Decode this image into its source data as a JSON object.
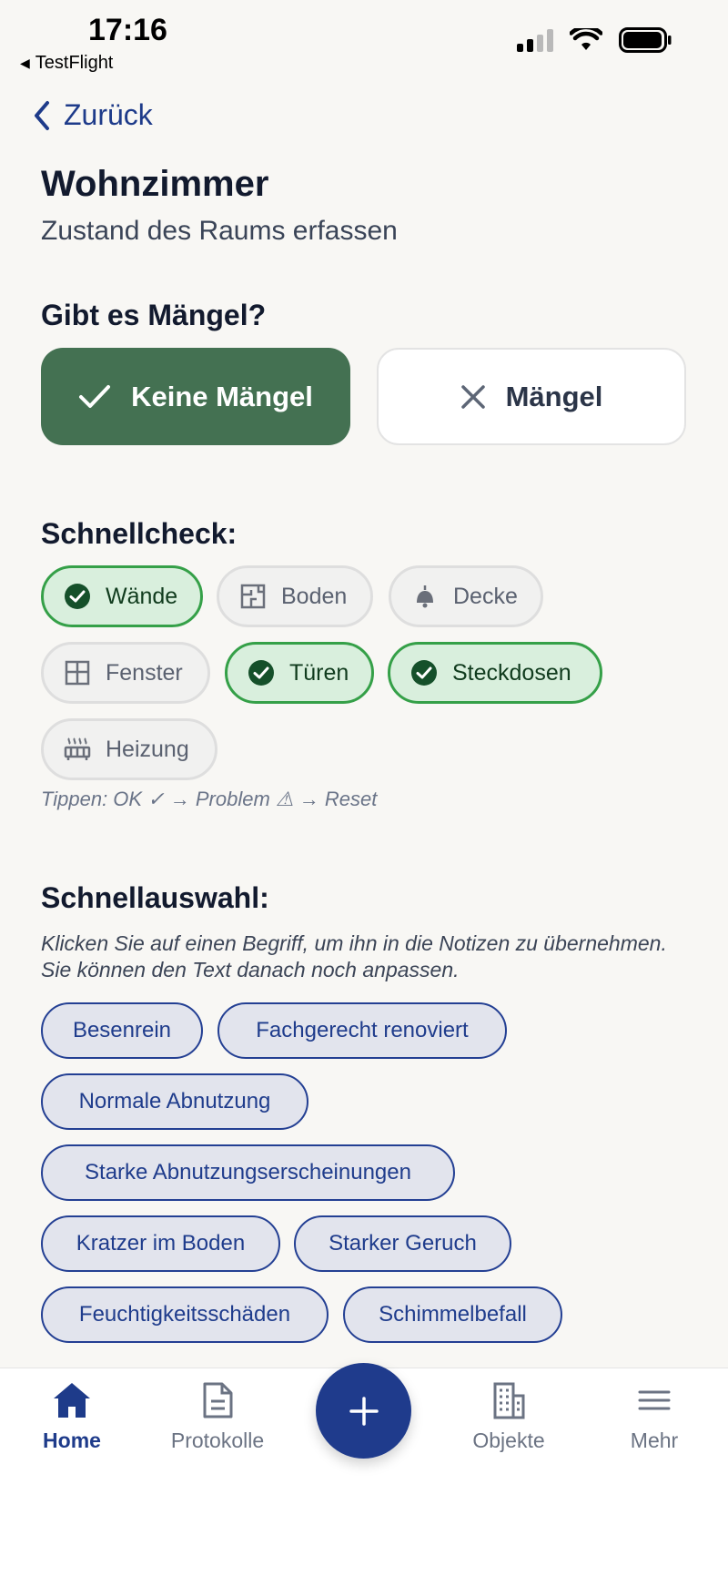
{
  "status_bar": {
    "time": "17:16",
    "back_app": "TestFlight"
  },
  "nav": {
    "back_label": "Zurück"
  },
  "header": {
    "title": "Wohnzimmer",
    "subtitle": "Zustand des Raums erfassen"
  },
  "defects": {
    "question": "Gibt es Mängel?",
    "no_defects_label": "Keine Mängel",
    "defects_label": "Mängel",
    "selected": "Keine Mängel"
  },
  "quickcheck": {
    "title": "Schnellcheck:",
    "items": [
      {
        "label": "Wände",
        "state": "ok",
        "icon": "check-circle-icon"
      },
      {
        "label": "Boden",
        "state": "none",
        "icon": "floorplan-icon"
      },
      {
        "label": "Decke",
        "state": "none",
        "icon": "ceiling-lamp-icon"
      },
      {
        "label": "Fenster",
        "state": "none",
        "icon": "window-icon"
      },
      {
        "label": "Türen",
        "state": "ok",
        "icon": "check-circle-icon"
      },
      {
        "label": "Steckdosen",
        "state": "ok",
        "icon": "check-circle-icon"
      },
      {
        "label": "Heizung",
        "state": "none",
        "icon": "heater-icon"
      }
    ],
    "hint": "Tippen: OK ✓ → Problem ⚠ → Reset"
  },
  "quickselect": {
    "title": "Schnellauswahl:",
    "description": "Klicken Sie auf einen Begriff, um ihn in die Notizen zu übernehmen. Sie können den Text danach noch anpassen.",
    "terms": [
      "Besenrein",
      "Fachgerecht renoviert",
      "Normale Abnutzung",
      "Starke Abnutzungserscheinungen",
      "Kratzer im Boden",
      "Starker Geruch",
      "Feuchtigkeitsschäden",
      "Schimmelbefall"
    ]
  },
  "tabbar": {
    "items": [
      {
        "label": "Home",
        "icon": "home-icon",
        "active": true
      },
      {
        "label": "Protokolle",
        "icon": "document-icon",
        "active": false
      },
      {
        "label": "Objekte",
        "icon": "building-icon",
        "active": false
      },
      {
        "label": "Mehr",
        "icon": "menu-icon",
        "active": false
      }
    ],
    "fab_icon": "plus-icon"
  },
  "colors": {
    "accent": "#1f3b8c",
    "ok_green": "#447152",
    "chip_ok_border": "#35a048",
    "background": "#f8f7f4"
  }
}
